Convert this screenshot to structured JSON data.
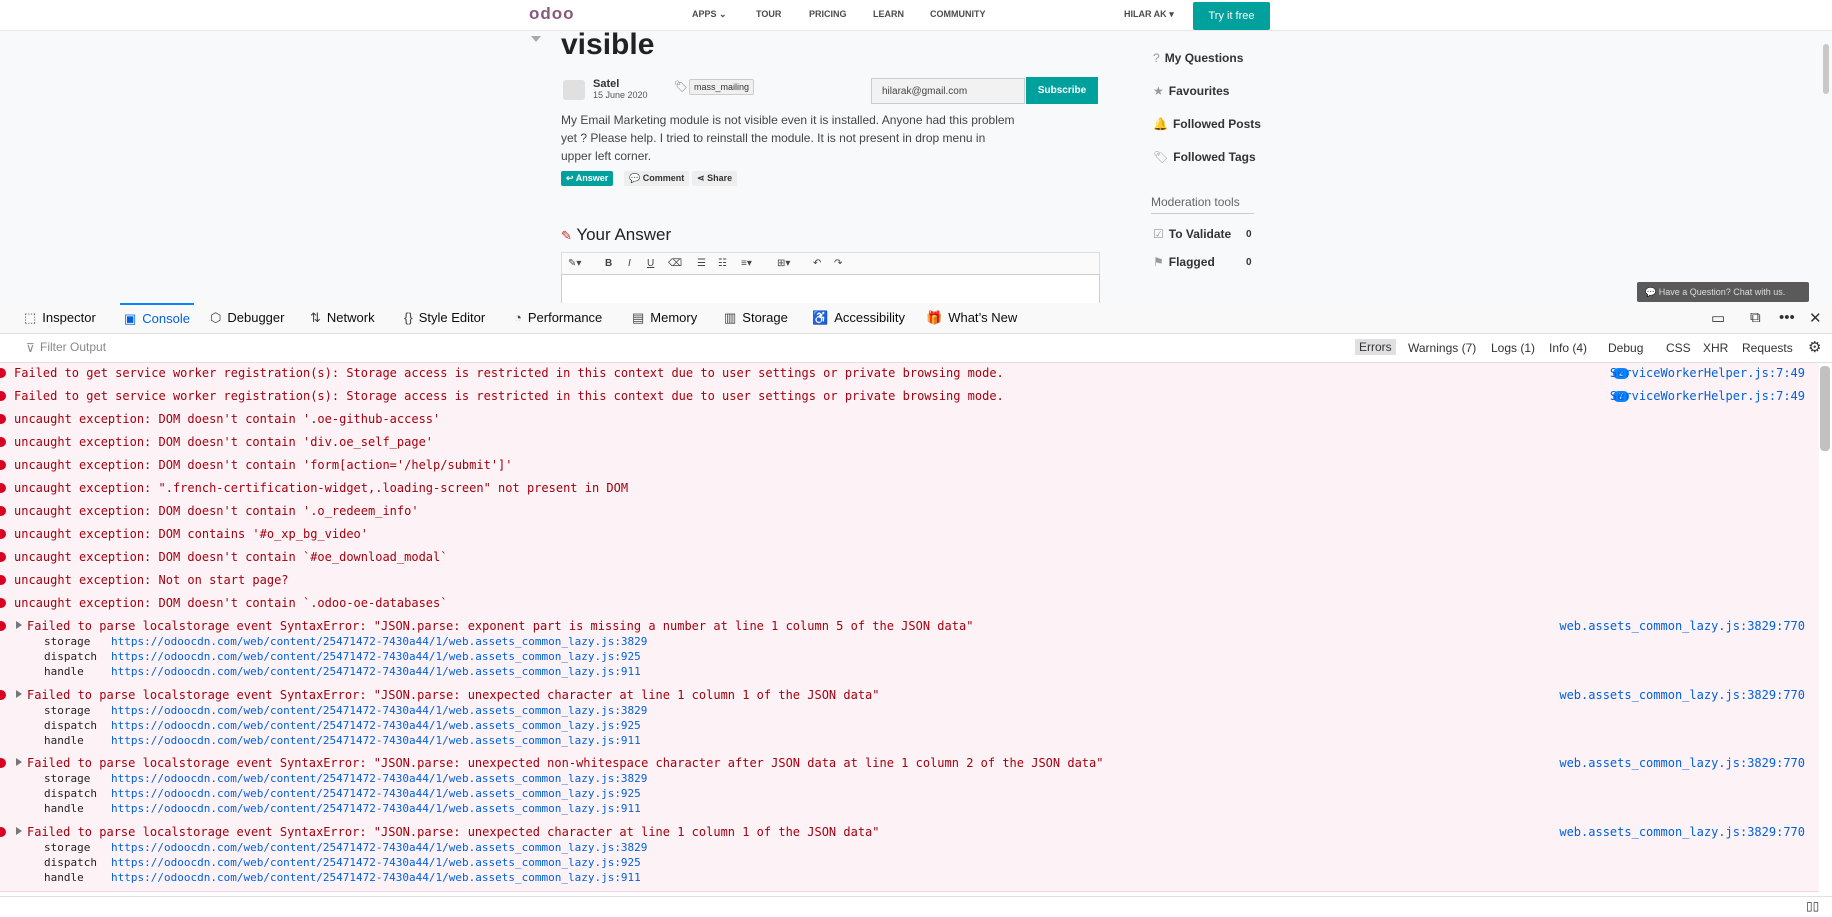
{
  "site": {
    "nav": {
      "logo": "odoo",
      "apps": "APPS",
      "tour": "TOUR",
      "pricing": "PRICING",
      "learn": "LEARN",
      "community": "COMMUNITY",
      "user": "HILAR AK",
      "try": "Try it free"
    },
    "question": {
      "title": "visible",
      "author": "Satel",
      "date": "15 June 2020",
      "tag": "mass_mailing",
      "email_value": "hilarak@gmail.com",
      "subscribe": "Subscribe",
      "body": "My Email Marketing module is not visible even it is installed. Anyone had this problem yet ? Please help. I tried to reinstall the module. It is not present in drop menu in upper left corner.",
      "answer": "Answer",
      "comment": "Comment",
      "share": "Share",
      "your_answer": "Your Answer"
    },
    "editor_tools": [
      "B",
      "I",
      "U"
    ],
    "sidebar": {
      "my_questions": "My Questions",
      "favourites": "Favourites",
      "followed_posts": "Followed Posts",
      "followed_tags": "Followed Tags",
      "moderation": "Moderation tools",
      "to_validate": "To Validate",
      "to_validate_count": "0",
      "flagged": "Flagged",
      "flagged_count": "0"
    },
    "chat": "Have a Question? Chat with us."
  },
  "devtools": {
    "tabs": [
      "Inspector",
      "Console",
      "Debugger",
      "Network",
      "Style Editor",
      "Performance",
      "Memory",
      "Storage",
      "Accessibility",
      "What’s New"
    ],
    "filter_placeholder": "Filter Output",
    "filters": [
      "Errors",
      "Warnings (7)",
      "Logs (1)",
      "Info (4)",
      "Debug",
      "CSS",
      "XHR",
      "Requests"
    ],
    "messages": [
      {
        "text": "Failed to get service worker registration(s): Storage access is restricted in this context due to user settings or private browsing mode.",
        "count": "2",
        "source": "ServiceWorkerHelper.js:7:49"
      },
      {
        "text": "Failed to get service worker registration(s): Storage access is restricted in this context due to user settings or private browsing mode.",
        "count": "7",
        "source": "ServiceWorkerHelper.js:7:49"
      },
      {
        "text": "uncaught exception: DOM doesn't contain '.oe-github-access'"
      },
      {
        "text": "uncaught exception: DOM doesn't contain 'div.oe_self_page'"
      },
      {
        "text": "uncaught exception: DOM doesn't contain 'form[action='/help/submit']'"
      },
      {
        "text": "uncaught exception: \".french-certification-widget,.loading-screen\" not present in DOM"
      },
      {
        "text": "uncaught exception: DOM doesn't contain '.o_redeem_info'"
      },
      {
        "text": "uncaught exception: DOM contains '#o_xp_bg_video'"
      },
      {
        "text": "uncaught exception: DOM doesn't contain `#oe_download_modal`"
      },
      {
        "text": "uncaught exception: Not on start page?"
      },
      {
        "text": "uncaught exception: DOM doesn't contain `.odoo-oe-databases`"
      }
    ],
    "parse_errors": [
      {
        "text": "Failed to parse localstorage event SyntaxError: \"JSON.parse: exponent part is missing a number at line 1 column 5 of the JSON data\"",
        "source": "web.assets_common_lazy.js:3829:770"
      },
      {
        "text": "Failed to parse localstorage event SyntaxError: \"JSON.parse: unexpected character at line 1 column 1 of the JSON data\"",
        "source": "web.assets_common_lazy.js:3829:770"
      },
      {
        "text": "Failed to parse localstorage event SyntaxError: \"JSON.parse: unexpected non-whitespace character after JSON data at line 1 column 2 of the JSON data\"",
        "source": "web.assets_common_lazy.js:3829:770"
      },
      {
        "text": "Failed to parse localstorage event SyntaxError: \"JSON.parse: unexpected character at line 1 column 1 of the JSON data\"",
        "source": "web.assets_common_lazy.js:3829:770"
      }
    ],
    "stack": [
      {
        "fn": "storage",
        "url": "https://odoocdn.com/web/content/25471472-7430a44/1/web.assets_common_lazy.js:3829"
      },
      {
        "fn": "dispatch",
        "url": "https://odoocdn.com/web/content/25471472-7430a44/1/web.assets_common_lazy.js:925"
      },
      {
        "fn": "handle",
        "url": "https://odoocdn.com/web/content/25471472-7430a44/1/web.assets_common_lazy.js:911"
      }
    ]
  }
}
